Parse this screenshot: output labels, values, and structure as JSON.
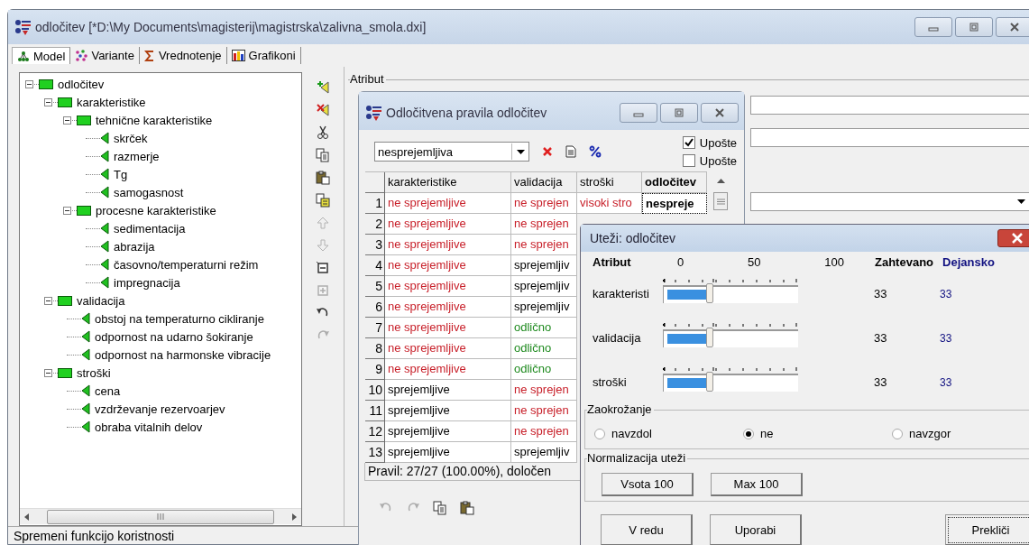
{
  "main_window": {
    "title": "odločitev [*D:\\My Documents\\magisterij\\magistrska\\zalivna_smola.dxi]"
  },
  "tabs": [
    {
      "label": "Model",
      "kind": "model",
      "selected": true
    },
    {
      "label": "Variante",
      "kind": "variants",
      "selected": false
    },
    {
      "label": "Vrednotenje",
      "kind": "evaluation",
      "selected": false
    },
    {
      "label": "Grafikoni",
      "kind": "charts",
      "selected": false
    }
  ],
  "tree": [
    {
      "label": "odločitev",
      "expanded": true,
      "children": [
        {
          "label": "karakteristike",
          "expanded": true,
          "children": [
            {
              "label": "tehnične karakteristike",
              "expanded": true,
              "children": [
                {
                  "label": "skrček"
                },
                {
                  "label": "razmerje"
                },
                {
                  "label": "Tg"
                },
                {
                  "label": "samogasnost"
                }
              ]
            },
            {
              "label": "procesne karakteristike",
              "expanded": true,
              "children": [
                {
                  "label": "sedimentacija"
                },
                {
                  "label": "abrazija"
                },
                {
                  "label": "časovno/temperaturni režim"
                },
                {
                  "label": "impregnacija"
                }
              ]
            }
          ]
        },
        {
          "label": "validacija",
          "expanded": true,
          "children": [
            {
              "label": "obstoj na temperaturno cikliranje"
            },
            {
              "label": "odpornost na udarno šokiranje"
            },
            {
              "label": "odpornost na harmonske vibracije"
            }
          ]
        },
        {
          "label": "stroški",
          "expanded": true,
          "children": [
            {
              "label": "cena"
            },
            {
              "label": "vzdrževanje rezervoarjev"
            },
            {
              "label": "obraba vitalnih delov"
            }
          ]
        }
      ]
    }
  ],
  "toolbar": [
    {
      "kind": "add",
      "disabled": false
    },
    {
      "kind": "delete",
      "disabled": false
    },
    {
      "kind": "cut",
      "disabled": false
    },
    {
      "kind": "copy",
      "disabled": false
    },
    {
      "kind": "paste",
      "disabled": false
    },
    {
      "kind": "paste-special",
      "disabled": false
    },
    {
      "kind": "up",
      "disabled": true
    },
    {
      "kind": "down",
      "disabled": true
    },
    {
      "kind": "collapse",
      "disabled": false
    },
    {
      "kind": "expand",
      "disabled": true
    },
    {
      "kind": "undo",
      "disabled": false
    },
    {
      "kind": "redo",
      "disabled": true
    }
  ],
  "attribute_panel": {
    "title": "Atribut"
  },
  "status_bar": "Spremeni funkcijo koristnosti",
  "rules_window": {
    "title": "Odločitvena pravila odločitev",
    "filter": "nesprejemljiva",
    "checkboxes": [
      {
        "label": "Upošte",
        "checked": true
      },
      {
        "label": "Upošte",
        "checked": false
      }
    ],
    "columns": [
      "karakteristike",
      "validacija",
      "stroški",
      "odločitev"
    ],
    "rows": [
      {
        "number": "1",
        "cells": [
          {
            "text": "ne sprejemljive",
            "color": "#c8202a",
            "focused": false
          },
          {
            "text": "ne sprejen",
            "color": "#c8202a",
            "focused": false
          },
          {
            "text": "visoki stro",
            "color": "#c8202a",
            "focused": false
          },
          {
            "text": "nespreje",
            "color": "#000000",
            "focused": true
          }
        ]
      },
      {
        "number": "2",
        "cells": [
          {
            "text": "ne sprejemljive",
            "color": "#c8202a",
            "focused": false
          },
          {
            "text": "ne sprejen",
            "color": "#c8202a",
            "focused": false
          }
        ]
      },
      {
        "number": "3",
        "cells": [
          {
            "text": "ne sprejemljive",
            "color": "#c8202a",
            "focused": false
          },
          {
            "text": "ne sprejen",
            "color": "#c8202a",
            "focused": false
          }
        ]
      },
      {
        "number": "4",
        "cells": [
          {
            "text": "ne sprejemljive",
            "color": "#c8202a",
            "focused": false
          },
          {
            "text": "sprejemljiv",
            "color": "#000000",
            "focused": false
          }
        ]
      },
      {
        "number": "5",
        "cells": [
          {
            "text": "ne sprejemljive",
            "color": "#c8202a",
            "focused": false
          },
          {
            "text": "sprejemljiv",
            "color": "#000000",
            "focused": false
          }
        ]
      },
      {
        "number": "6",
        "cells": [
          {
            "text": "ne sprejemljive",
            "color": "#c8202a",
            "focused": false
          },
          {
            "text": "sprejemljiv",
            "color": "#000000",
            "focused": false
          }
        ]
      },
      {
        "number": "7",
        "cells": [
          {
            "text": "ne sprejemljive",
            "color": "#c8202a",
            "focused": false
          },
          {
            "text": "odlično",
            "color": "#1e8a1e",
            "focused": false
          }
        ]
      },
      {
        "number": "8",
        "cells": [
          {
            "text": "ne sprejemljive",
            "color": "#c8202a",
            "focused": false
          },
          {
            "text": "odlično",
            "color": "#1e8a1e",
            "focused": false
          }
        ]
      },
      {
        "number": "9",
        "cells": [
          {
            "text": "ne sprejemljive",
            "color": "#c8202a",
            "focused": false
          },
          {
            "text": "odlično",
            "color": "#1e8a1e",
            "focused": false
          }
        ]
      },
      {
        "number": "10",
        "cells": [
          {
            "text": "sprejemljive",
            "color": "#000000",
            "focused": false
          },
          {
            "text": "ne sprejen",
            "color": "#c8202a",
            "focused": false
          }
        ]
      },
      {
        "number": "11",
        "cells": [
          {
            "text": "sprejemljive",
            "color": "#000000",
            "focused": false
          },
          {
            "text": "ne sprejen",
            "color": "#c8202a",
            "focused": false
          }
        ]
      },
      {
        "number": "12",
        "cells": [
          {
            "text": "sprejemljive",
            "color": "#000000",
            "focused": false
          },
          {
            "text": "ne sprejen",
            "color": "#c8202a",
            "focused": false
          }
        ]
      },
      {
        "number": "13",
        "cells": [
          {
            "text": "sprejemljive",
            "color": "#000000",
            "focused": false
          },
          {
            "text": "sprejemljiv",
            "color": "#000000",
            "focused": false
          }
        ]
      }
    ],
    "summary": "Pravil: 27/27 (100.00%), določen",
    "bottom_toolbar": [
      {
        "kind": "undo",
        "disabled": true
      },
      {
        "kind": "redo",
        "disabled": true
      },
      {
        "kind": "copy",
        "disabled": false
      },
      {
        "kind": "paste",
        "disabled": false
      }
    ]
  },
  "weights_dialog": {
    "title": "Uteži: odločitev",
    "header": {
      "attribute": "Atribut",
      "scale": [
        "0",
        "50",
        "100"
      ],
      "required": "Zahtevano",
      "actual": "Dejansko"
    },
    "rows": [
      {
        "label": "karakteristi",
        "level": 0.33,
        "required": "33",
        "actual": "33"
      },
      {
        "label": "validacija",
        "level": 0.33,
        "required": "33",
        "actual": "33"
      },
      {
        "label": "stroški",
        "level": 0.33,
        "required": "33",
        "actual": "33"
      }
    ],
    "rounding": {
      "title": "Zaokrožanje",
      "options": [
        {
          "label": "navzdol",
          "selected": false
        },
        {
          "label": "ne",
          "selected": true
        },
        {
          "label": "navzgor",
          "selected": false
        }
      ]
    },
    "normalization": {
      "title": "Normalizacija uteži",
      "buttons": [
        "Vsota 100",
        "Max 100"
      ]
    },
    "buttons": [
      {
        "label": "V redu",
        "kind": "ok"
      },
      {
        "label": "Uporabi",
        "kind": "apply"
      },
      {
        "label": "Prekliči",
        "kind": "cancel"
      }
    ]
  }
}
